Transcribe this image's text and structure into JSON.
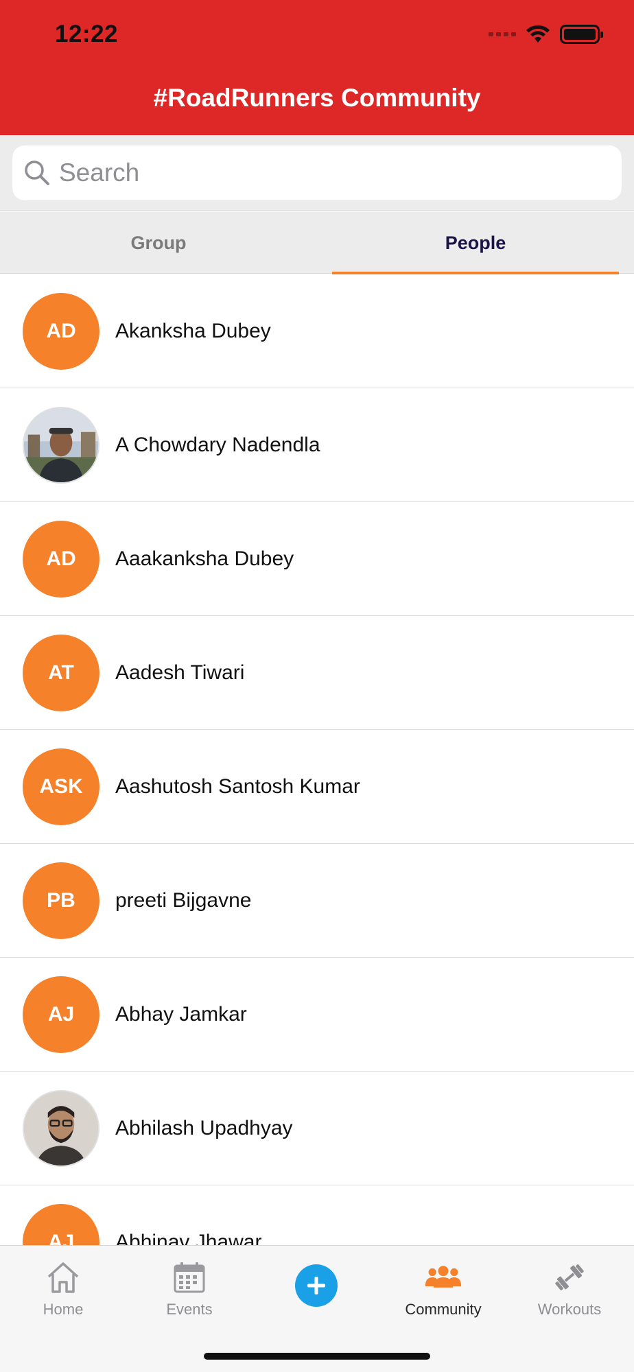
{
  "status_bar": {
    "time": "12:22"
  },
  "header": {
    "title": "#RoadRunners Community"
  },
  "search": {
    "placeholder": "Search"
  },
  "tabs": [
    {
      "label": "Group",
      "active": false
    },
    {
      "label": "People",
      "active": true
    }
  ],
  "people": [
    {
      "initials": "AD",
      "name": "Akanksha Dubey"
    },
    {
      "initials": "",
      "name": "A Chowdary Nadendla",
      "photo": true
    },
    {
      "initials": "AD",
      "name": "Aaakanksha Dubey"
    },
    {
      "initials": "AT",
      "name": "Aadesh Tiwari"
    },
    {
      "initials": "ASK",
      "name": "Aashutosh Santosh Kumar"
    },
    {
      "initials": "PB",
      "name": "preeti Bijgavne"
    },
    {
      "initials": "AJ",
      "name": "Abhay Jamkar"
    },
    {
      "initials": "",
      "name": "Abhilash Upadhyay",
      "photo": true
    },
    {
      "initials": "AJ",
      "name": "Abhinav Jhawar"
    }
  ],
  "tabbar": {
    "home": "Home",
    "events": "Events",
    "community": "Community",
    "workouts": "Workouts"
  },
  "colors": {
    "header": "#de2727",
    "accent": "#f5822b",
    "add_button": "#1aa0e6",
    "tab_active_text": "#1b1448"
  }
}
